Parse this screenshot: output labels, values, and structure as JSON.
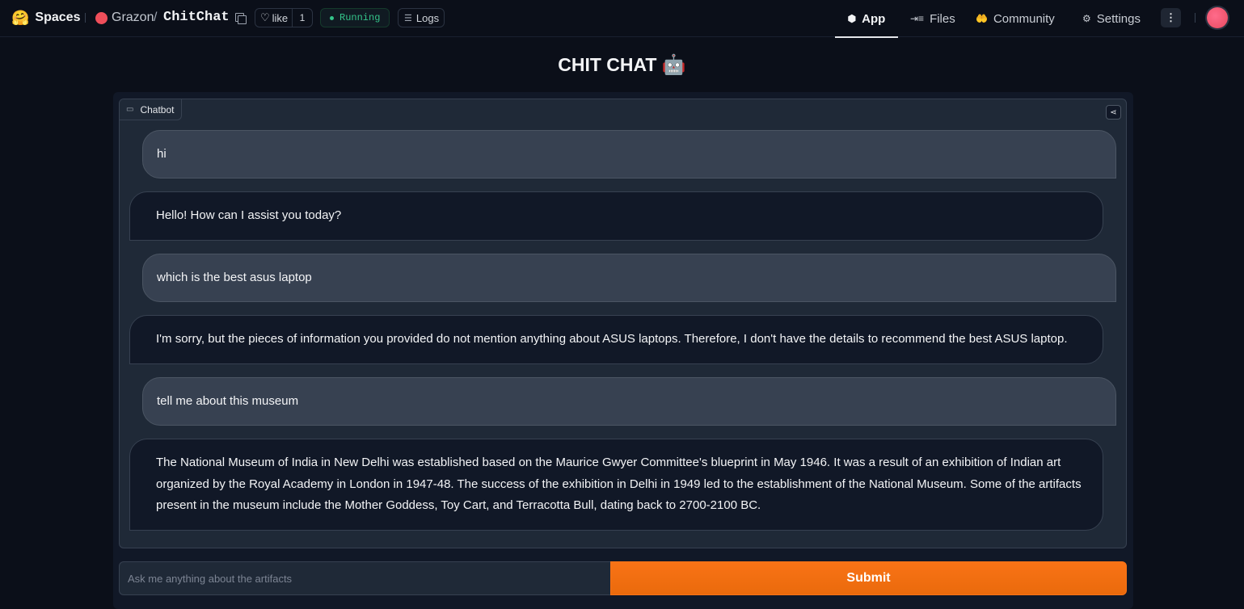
{
  "header": {
    "brand": "Spaces",
    "owner": "Grazon",
    "separator": "/",
    "repo": "ChitChat",
    "like_label": "like",
    "like_count": "1",
    "status": "Running",
    "logs_label": "Logs",
    "tabs": [
      {
        "label": "App",
        "icon": "cube-icon",
        "glyph": "⬢"
      },
      {
        "label": "Files",
        "icon": "files-icon",
        "glyph": "⇥≡"
      },
      {
        "label": "Community",
        "icon": "community-icon",
        "glyph": "🤲"
      },
      {
        "label": "Settings",
        "icon": "gear-icon",
        "glyph": "⚙"
      }
    ],
    "active_tab": "App"
  },
  "app": {
    "title": "CHIT CHAT",
    "title_emoji": "🤖",
    "chatbot_label": "Chatbot",
    "messages": [
      {
        "role": "user",
        "text": "hi"
      },
      {
        "role": "bot",
        "text": "Hello! How can I assist you today?"
      },
      {
        "role": "user",
        "text": "which is the best asus laptop"
      },
      {
        "role": "bot",
        "text": "I'm sorry, but the pieces of information you provided do not mention anything about ASUS laptops. Therefore, I don't have the details to recommend the best ASUS laptop."
      },
      {
        "role": "user",
        "text": "tell me about this museum"
      },
      {
        "role": "bot",
        "text": "The National Museum of India in New Delhi was established based on the Maurice Gwyer Committee's blueprint in May 1946. It was a result of an exhibition of Indian art organized by the Royal Academy in London in 1947-48. The success of the exhibition in Delhi in 1949 led to the establishment of the National Museum. Some of the artifacts present in the museum include the Mother Goddess, Toy Cart, and Terracotta Bull, dating back to 2700-2100 BC."
      }
    ],
    "input_value": "",
    "input_placeholder": "Ask me anything about the artifacts",
    "submit_label": "Submit"
  },
  "colors": {
    "background": "#0b0f19",
    "accent": "#f97316",
    "running": "#34c48a",
    "user_bubble": "#374151",
    "bot_bubble": "#111827"
  }
}
